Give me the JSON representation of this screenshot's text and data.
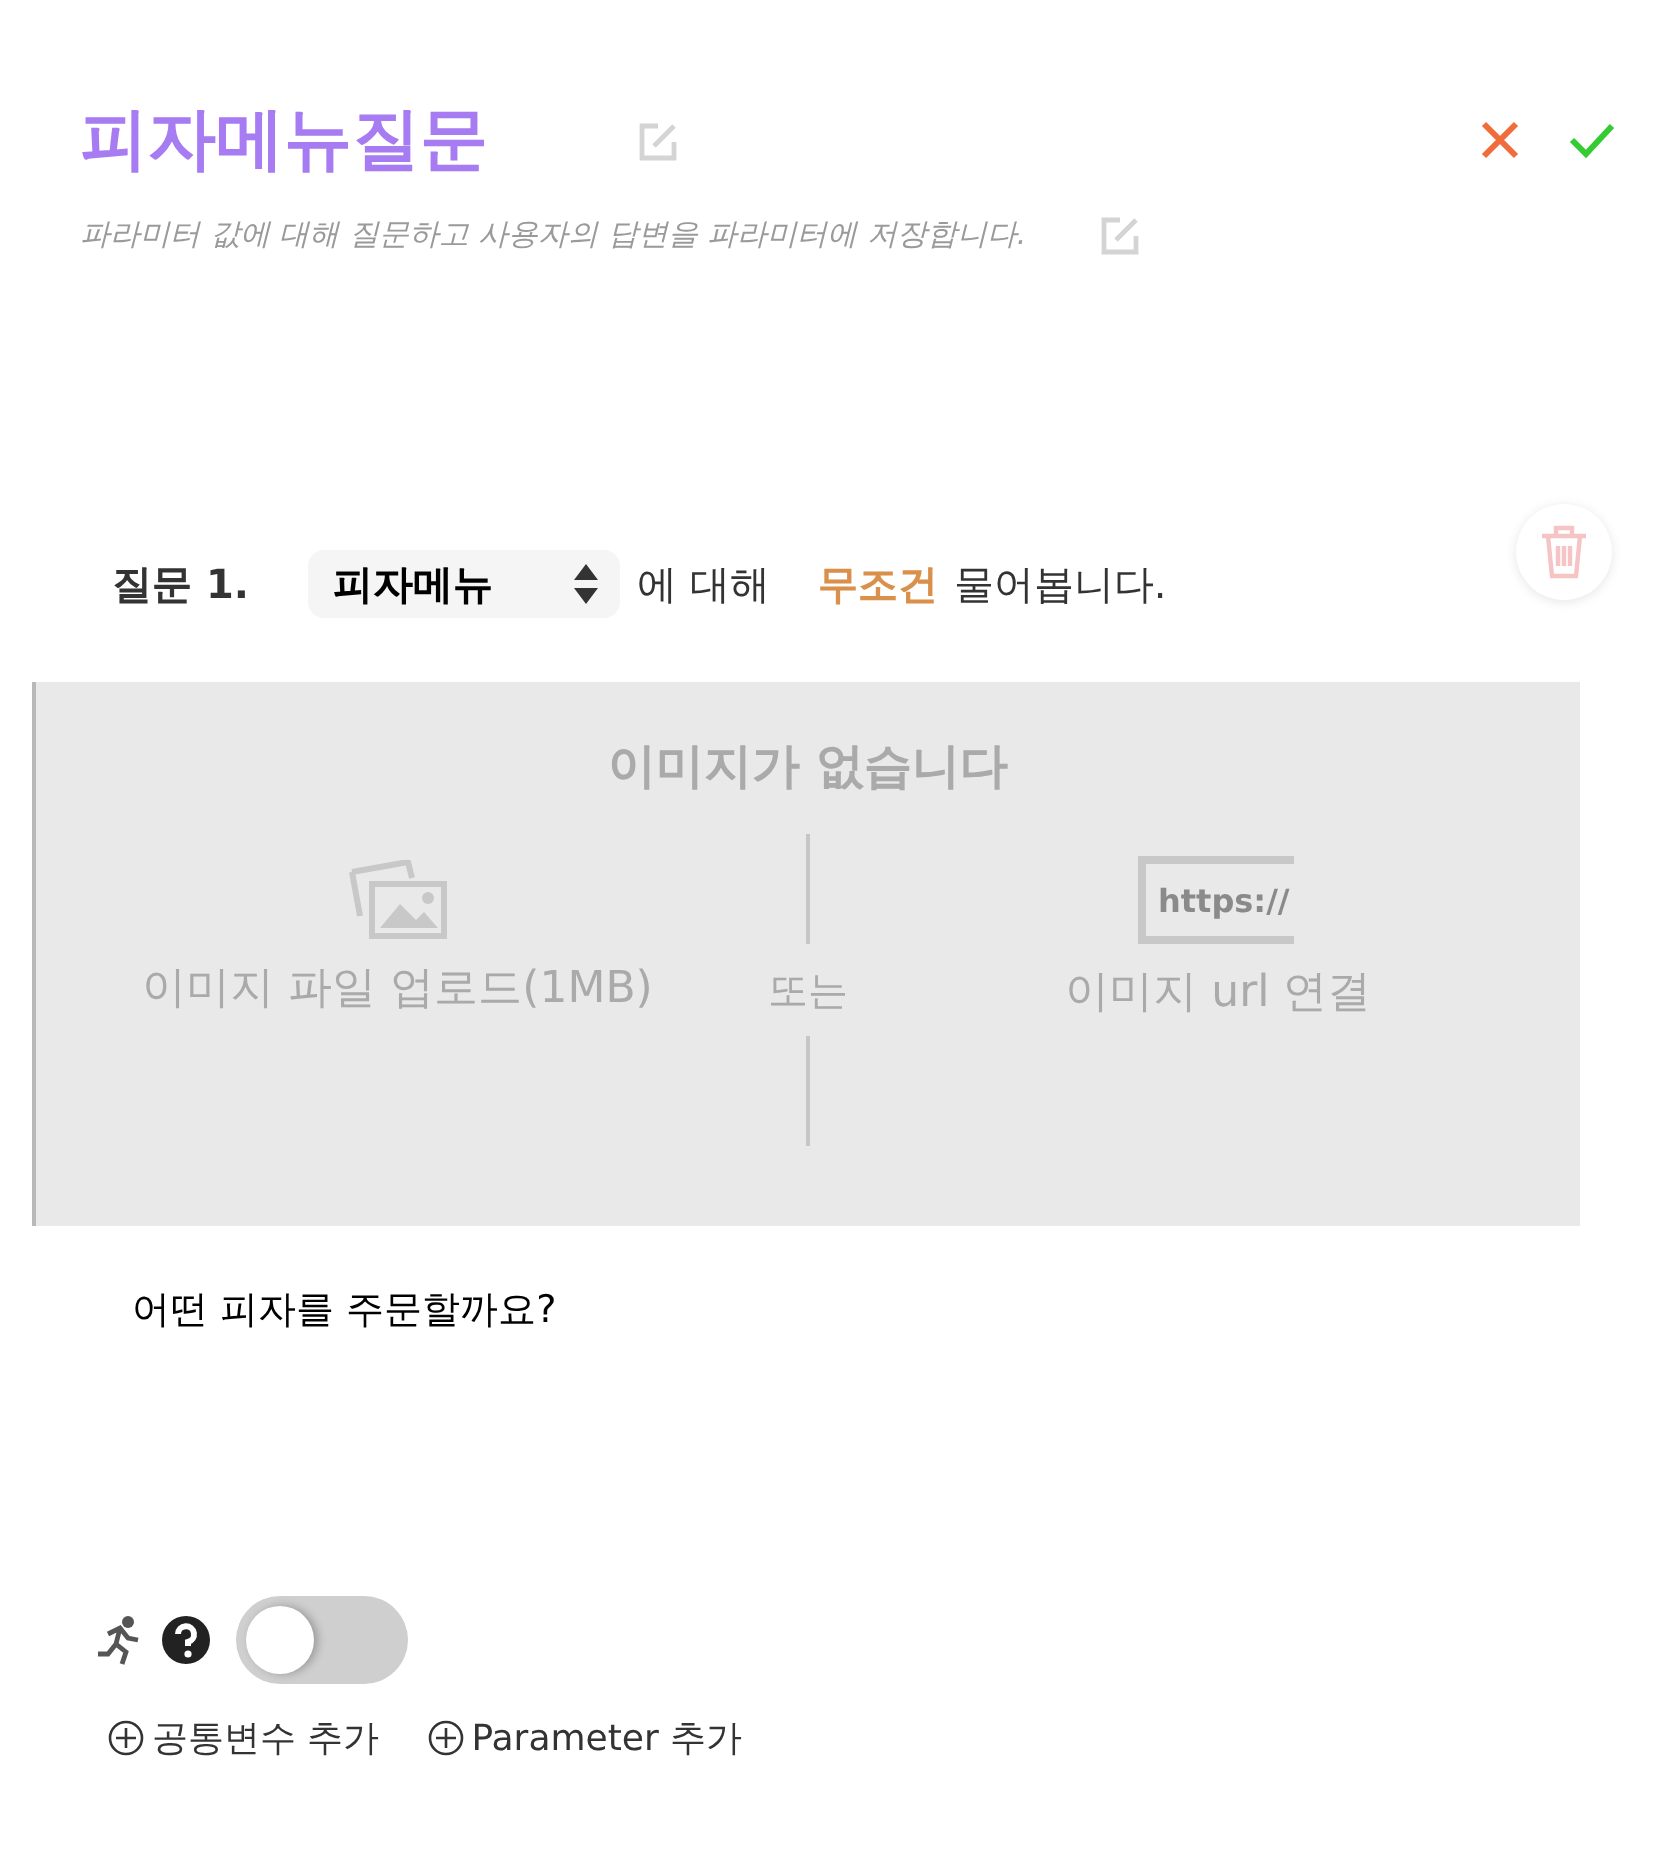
{
  "header": {
    "title": "피자메뉴질문",
    "description": "파라미터 값에 대해 질문하고 사용자의 답변을 파라미터에 저장합니다."
  },
  "question": {
    "label": "질문 1.",
    "parameter": "피자메뉴",
    "about": "에 대해",
    "condition": "무조건",
    "ask": "물어봅니다."
  },
  "image": {
    "empty_text": "이미지가 없습니다",
    "upload": "이미지 파일 업로드(1MB)",
    "or": "또는",
    "url_icon_text": "https://",
    "url": "이미지 url 연결"
  },
  "prompt": {
    "value": "어떤 피자를 주문할까요?"
  },
  "toggle": {
    "on": false
  },
  "add_links": [
    "공통변수 추가",
    "Parameter 추가"
  ]
}
